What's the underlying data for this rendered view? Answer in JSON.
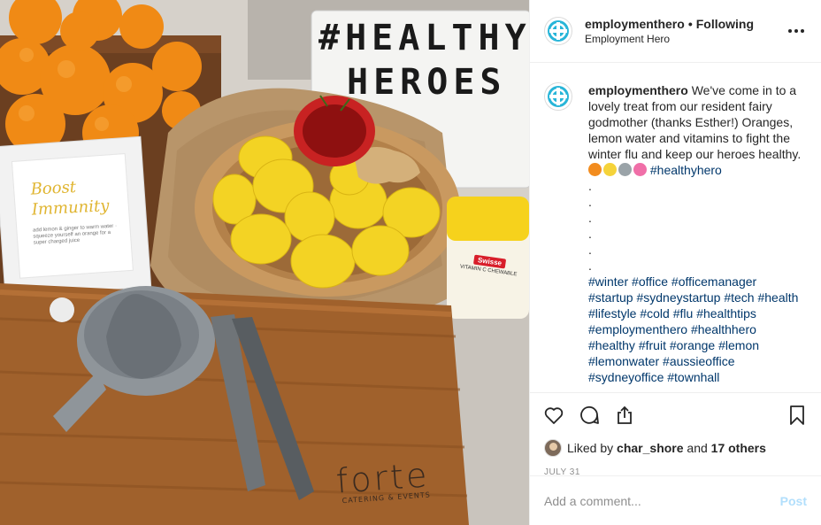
{
  "photo": {
    "lightbox_line1": "#HEALTHY",
    "lightbox_line2": "HEROES",
    "frame_title": "Boost Immunity",
    "frame_small": "add lemon & ginger to warm water · squeeze yourself an orange for a super charged juice",
    "board_brand": "forte",
    "board_sub": "CATERING & EVENTS",
    "jar_brand": "Swisse",
    "jar_product": "VITAMIN C CHEWABLE"
  },
  "header": {
    "username": "employmenthero",
    "separator": "•",
    "follow_status": "Following",
    "subtitle": "Employment Hero",
    "more_icon": "more-horizontal-icon"
  },
  "caption": {
    "username": "employmenthero",
    "text": "We've come in to a lovely treat from our resident fairy godmother (thanks Esther!) Oranges, lemon water and vitamins to fight the winter flu and keep our heroes healthy.",
    "emojis": [
      {
        "name": "orange-emoji",
        "color": "#f28c1e"
      },
      {
        "name": "lemon-emoji",
        "color": "#f5d33a"
      },
      {
        "name": "pill-jar-emoji",
        "color": "#9aa3a8"
      },
      {
        "name": "sparkling-heart-emoji",
        "color": "#f06fa8"
      }
    ],
    "first_tag": "#healthyhero",
    "dots": [
      ".",
      ".",
      ".",
      ".",
      ".",
      "."
    ],
    "tag_lines": [
      [
        "#winter",
        "#office",
        "#officemanager"
      ],
      [
        "#startup",
        "#sydneystartup",
        "#tech",
        "#health"
      ],
      [
        "#lifestyle",
        "#cold",
        "#flu",
        "#healthtips"
      ],
      [
        "#employmenthero",
        "#healthhero"
      ],
      [
        "#healthy",
        "#fruit",
        "#orange",
        "#lemon"
      ],
      [
        "#lemonwater",
        "#aussieoffice"
      ],
      [
        "#sydneyoffice",
        "#townhall"
      ]
    ]
  },
  "actions": {
    "like_icon": "heart-icon",
    "comment_icon": "comment-icon",
    "share_icon": "share-icon",
    "save_icon": "bookmark-icon"
  },
  "likes": {
    "prefix": "Liked by",
    "user": "char_shore",
    "connector": "and",
    "others": "17 others"
  },
  "date": "JULY 31",
  "comment": {
    "placeholder": "Add a comment...",
    "post_label": "Post"
  },
  "colors": {
    "link": "#00376b",
    "brand_teal": "#28b5d8",
    "post_disabled": "#b2dffc",
    "muted": "#8e8e8e"
  }
}
